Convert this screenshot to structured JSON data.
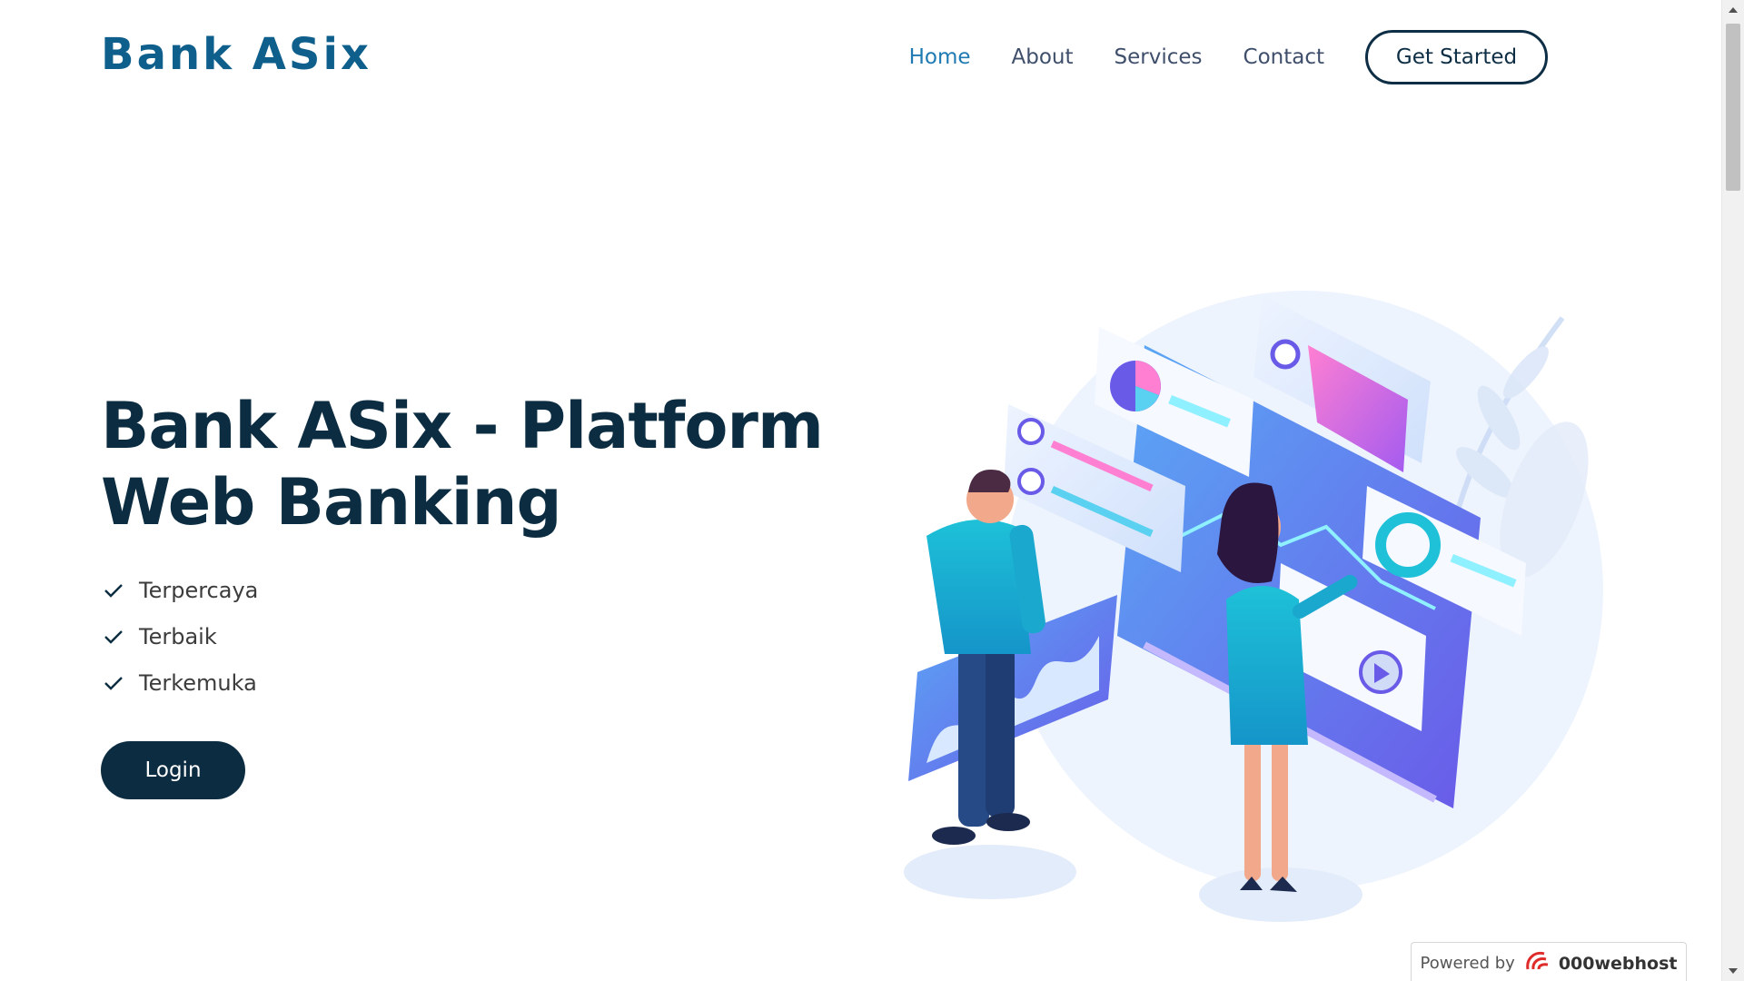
{
  "header": {
    "brand": "Bank ASix",
    "nav": [
      {
        "label": "Home",
        "active": true
      },
      {
        "label": "About",
        "active": false
      },
      {
        "label": "Services",
        "active": false
      },
      {
        "label": "Contact",
        "active": false
      }
    ],
    "cta_label": "Get Started"
  },
  "hero": {
    "title_line1": "Bank ASix - Platform",
    "title_line2": "Web Banking",
    "features": [
      "Terpercaya",
      "Terbaik",
      "Terkemuka"
    ],
    "login_label": "Login",
    "illustration_icon": "people-with-dashboard-illustration"
  },
  "badge": {
    "prefix": "Powered by",
    "host": "000webhost"
  },
  "colors": {
    "brand": "#0f5f8c",
    "heading": "#0c2d41",
    "nav_active": "#1f7ab3",
    "nav": "#3f4f6b",
    "login_bg": "#0c2d41"
  }
}
